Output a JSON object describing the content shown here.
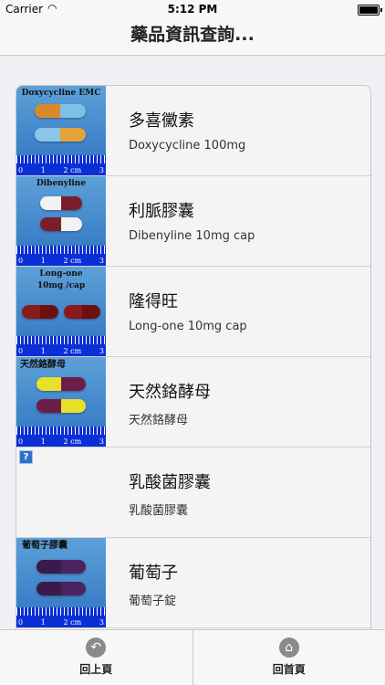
{
  "status": {
    "carrier": "Carrier",
    "time": "5:12 PM"
  },
  "nav": {
    "title": "藥品資訊查詢..."
  },
  "drugs": [
    {
      "name": "多喜黴素",
      "desc": "Doxycycline 100mg",
      "image_caption": "Doxycycline EMC",
      "has_image": true
    },
    {
      "name": "利脈膠囊",
      "desc": "Dibenyline 10mg cap",
      "image_caption": "Dibenyline",
      "has_image": true
    },
    {
      "name": "隆得旺",
      "desc": "Long-one 10mg cap",
      "image_caption": "Long-one 10mg /cap",
      "has_image": true
    },
    {
      "name": "天然鉻酵母",
      "desc": "天然鉻酵母",
      "image_caption": "天然鉻酵母",
      "has_image": true
    },
    {
      "name": "乳酸菌膠囊",
      "desc": "乳酸菌膠囊",
      "image_caption": "?",
      "has_image": false
    },
    {
      "name": "葡萄子",
      "desc": "葡萄子錠",
      "image_caption": "葡萄子膠囊",
      "has_image": true
    }
  ],
  "ruler": {
    "n0": "0",
    "n1": "1",
    "n2": "2",
    "unit": "cm",
    "n3": "3"
  },
  "tabs": [
    {
      "label": "回上頁",
      "icon": "back-arrow-icon"
    },
    {
      "label": "回首頁",
      "icon": "home-icon"
    }
  ]
}
